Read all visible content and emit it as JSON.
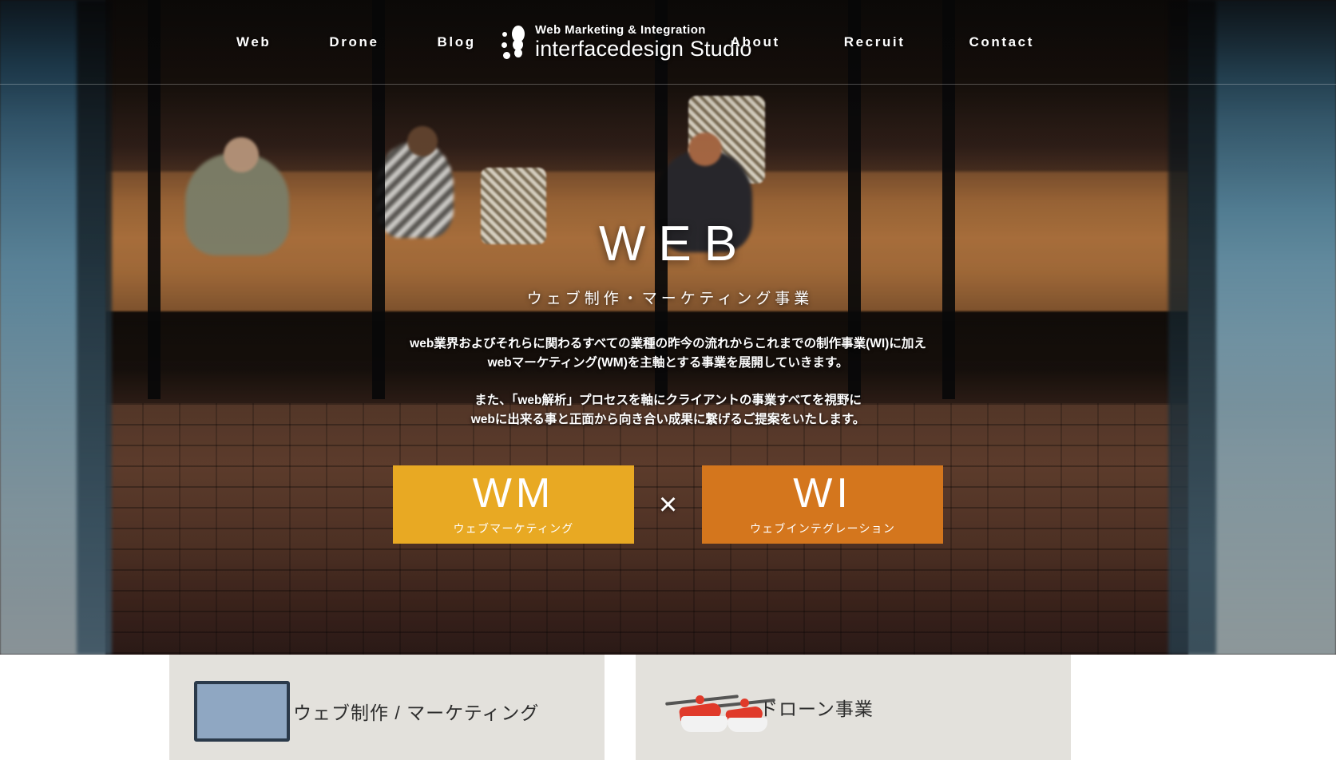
{
  "nav": {
    "left_links": [
      {
        "label": "Web",
        "name": "nav-link-web"
      },
      {
        "label": "Drone",
        "name": "nav-link-drone"
      },
      {
        "label": "Blog",
        "name": "nav-link-blog"
      }
    ],
    "right_links": [
      {
        "label": "About",
        "name": "nav-link-about"
      },
      {
        "label": "Recruit",
        "name": "nav-link-recruit"
      },
      {
        "label": "Contact",
        "name": "nav-link-contact"
      }
    ],
    "brand": {
      "tagline": "Web Marketing & Integration",
      "name": "interfacedesign Studio",
      "logo_icon": "footprint-logo-icon"
    }
  },
  "hero": {
    "title": "WEB",
    "subtitle": "ウェブ制作・マーケティング事業",
    "paragraph1_line1": "web業界およびそれらに関わるすべての業種の昨今の流れからこれまでの制作事業(WI)に加え",
    "paragraph1_line2": "webマーケティング(WM)を主軸とする事業を展開していきます。",
    "paragraph2_line1": "また、「web解析」プロセスを軸にクライアントの事業すべてを視野に",
    "paragraph2_line2": "webに出来る事と正面から向き合い成果に繋げるご提案をいたします。",
    "badges": {
      "wm": {
        "code": "WM",
        "label": "ウェブマーケティング",
        "color": "#E8A923"
      },
      "separator": "×",
      "wi": {
        "code": "WI",
        "label": "ウェブインテグレーション",
        "color": "#D4761D"
      }
    }
  },
  "cards": [
    {
      "title": "ウェブ制作 / マーケティング",
      "icon": "monitor-icon",
      "icon_color": "#8FA7C2"
    },
    {
      "title": "ドローン事業",
      "icon": "drone-icon",
      "icon_color": "#e03a2a"
    }
  ],
  "theme": {
    "card_bg": "#E3E1DC",
    "page_bg": "#FFFFFF",
    "text_light": "#FFFFFF"
  }
}
